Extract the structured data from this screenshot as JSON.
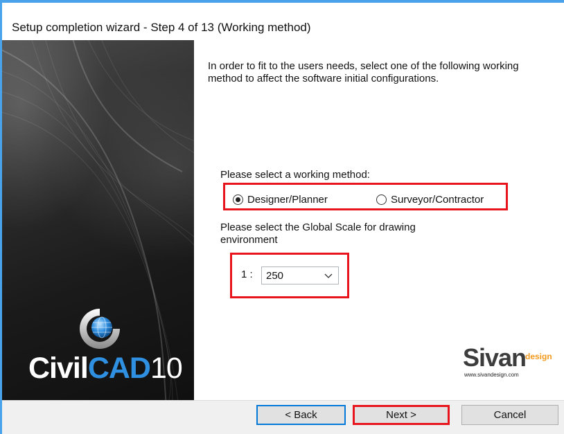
{
  "window": {
    "title": "Setup completion wizard - Step 4 of 13  (Working method)"
  },
  "intro_text": "In order to fit to the users needs, select one of the following working method to affect the software initial configurations.",
  "working_method": {
    "label": "Please select a working method:",
    "options": [
      {
        "label": "Designer/Planner",
        "selected": true
      },
      {
        "label": "Surveyor/Contractor",
        "selected": false
      }
    ]
  },
  "global_scale": {
    "label": "Please select the Global Scale for drawing environment",
    "prefix": "1 :",
    "value": "250"
  },
  "sidebar": {
    "logo": {
      "civil": "Civil",
      "cad": "CAD",
      "version": "10"
    }
  },
  "brand": {
    "name": "Sivan",
    "design": "design",
    "url": "www.sivandesign.com"
  },
  "buttons": {
    "back": "< Back",
    "next": "Next >",
    "cancel": "Cancel"
  },
  "colors": {
    "highlight": "#e8141b",
    "window_border": "#4aa3ea",
    "cad_blue": "#2f8fe0",
    "design_orange": "#f39a1e"
  }
}
